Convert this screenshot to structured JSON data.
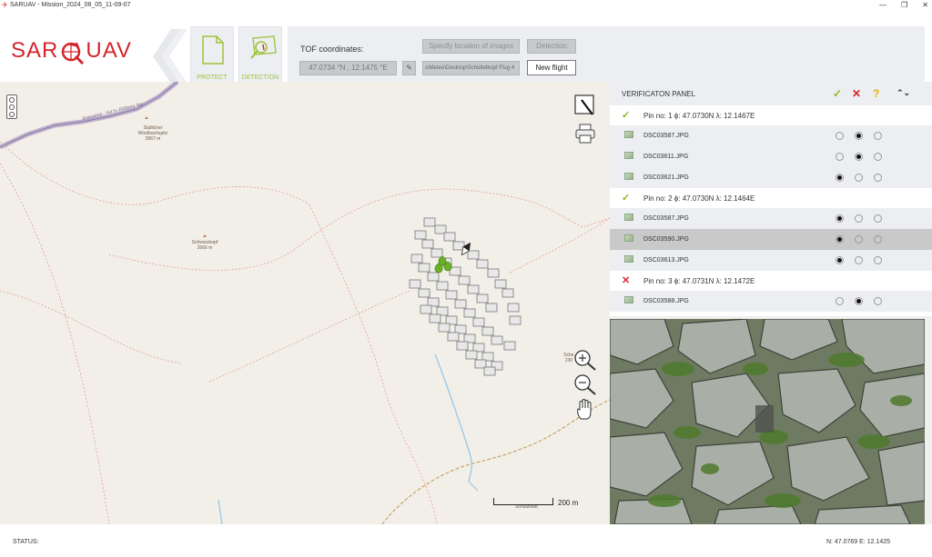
{
  "window": {
    "title": "SARUAV - Mission_2024_08_05_11-09-07",
    "controls": [
      "—",
      "❐",
      "✕"
    ]
  },
  "logo": {
    "left": "SAR",
    "right": "UAV"
  },
  "modes": [
    {
      "label": "PROTECT",
      "icon": "document-icon"
    },
    {
      "label": "DETECTION",
      "icon": "detection-icon"
    }
  ],
  "tof": {
    "label": "TOF coordinates:",
    "value": "47.0734 °N , 12.1475 °E",
    "specify_label": "Specify location of images",
    "detection_label": "Detection",
    "path_value": "s\\Meteo\\Desktop\\Schüttelkopf Flug 4",
    "new_flight_label": "New flight"
  },
  "map": {
    "labels": [
      {
        "text": "Poisserial - Vul H.-Rißberg-Stg"
      },
      {
        "text": "Südlicher Windbachspitz 2867 m"
      },
      {
        "text": "Schwarzkopf 2666 m"
      },
      {
        "text": "Sche 230"
      },
      {
        "text": "Schutzblatt"
      }
    ],
    "scale_label": "200 m"
  },
  "verification": {
    "title": "VERIFICATON PANEL",
    "header_icons": {
      "accept": "✓",
      "reject": "✕",
      "unknown": "?"
    },
    "arrows": "⌃⌄",
    "pins": [
      {
        "status": "✓",
        "status_color": "#8dbb1e",
        "text": "Pin no:  1 ϕ: 47.0730N λ: 12.1467E",
        "images": [
          {
            "file": "DSC03587.JPG",
            "choice": 1
          },
          {
            "file": "DSC03611.JPG",
            "choice": 1
          },
          {
            "file": "DSC03621.JPG",
            "choice": 0
          }
        ]
      },
      {
        "status": "✓",
        "status_color": "#8dbb1e",
        "text": "Pin no:  2 ϕ: 47.0730N λ: 12.1464E",
        "images": [
          {
            "file": "DSC03587.JPG",
            "choice": 0
          },
          {
            "file": "DSC03590.JPG",
            "choice": 0,
            "selected": true
          },
          {
            "file": "DSC03613.JPG",
            "choice": 0
          }
        ]
      },
      {
        "status": "✕",
        "status_color": "#d3262c",
        "text": "Pin no:  3 ϕ: 47.0731N λ: 12.1472E",
        "images": [
          {
            "file": "DSC03588.JPG",
            "choice": 1
          }
        ]
      }
    ]
  },
  "status": {
    "label": "STATUS:",
    "coords": "N: 47.0769 E: 12.1425"
  },
  "colors": {
    "accent": "#9ec23b",
    "brand": "#d3262c"
  }
}
